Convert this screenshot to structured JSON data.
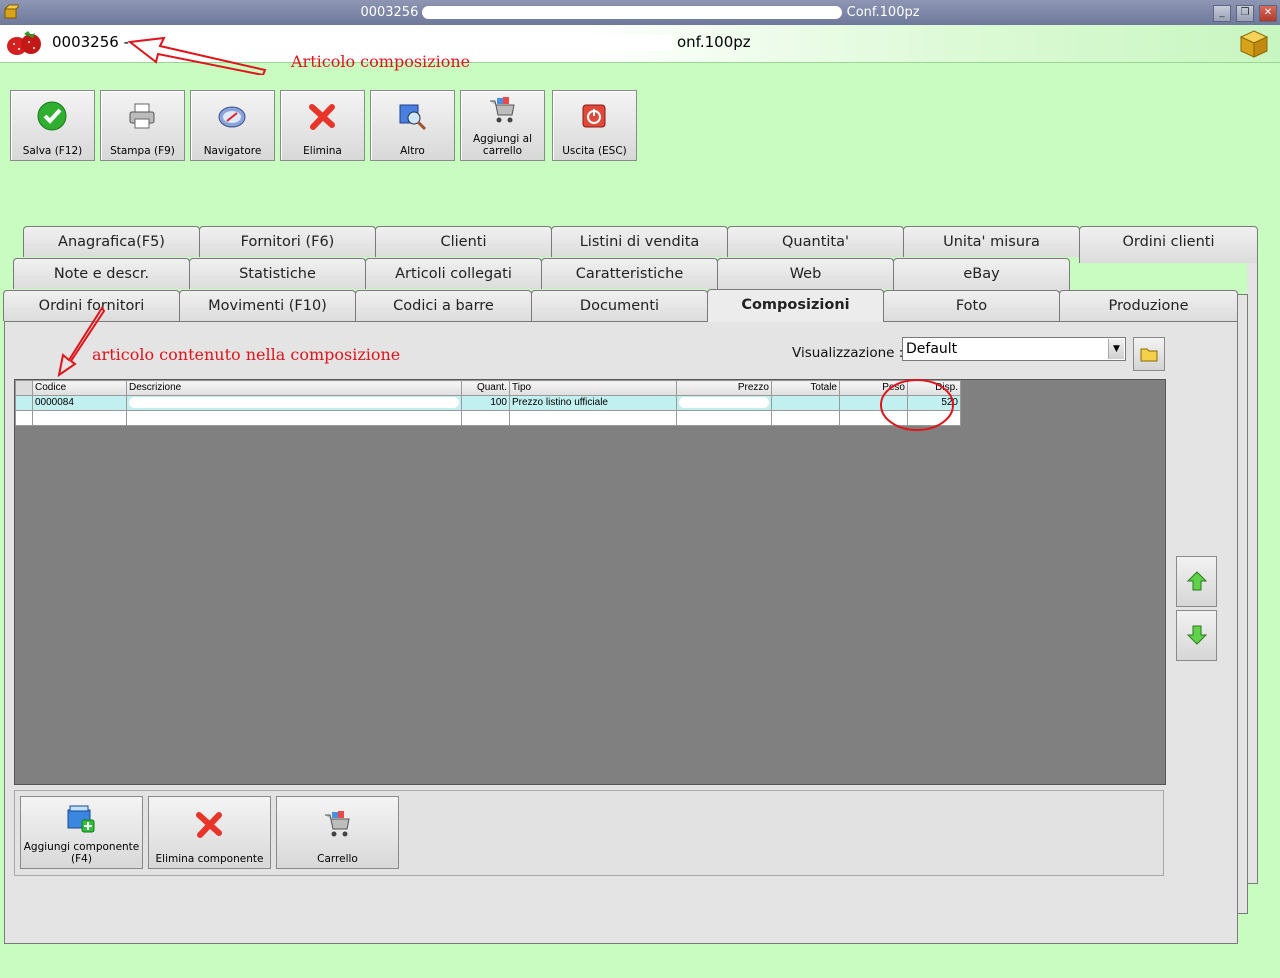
{
  "window": {
    "title_code": "0003256",
    "title_suffix": "Conf.100pz",
    "controls": [
      "_",
      "❐",
      "✕"
    ]
  },
  "header": {
    "article_code": "0003256 -",
    "article_suffix": "onf.100pz"
  },
  "annotations": {
    "top_note": "Articolo composizione",
    "grid_note": "articolo contenuto nella composizione"
  },
  "toolbar": {
    "save": "Salva (F12)",
    "print": "Stampa (F9)",
    "navigator": "Navigatore",
    "delete": "Elimina",
    "other": "Altro",
    "add_to_cart_1": "Aggiungi al",
    "add_to_cart_2": "carrello",
    "exit": "Uscita (ESC)"
  },
  "tabs": {
    "row1": [
      "Anagrafica(F5)",
      "Fornitori (F6)",
      "Clienti",
      "Listini di vendita",
      "Quantita'",
      "Unita' misura",
      "Ordini clienti"
    ],
    "row2": [
      "Note e descr.",
      "Statistiche",
      "Articoli collegati",
      "Caratteristiche",
      "Web",
      "eBay"
    ],
    "row3": [
      "Ordini fornitori",
      "Movimenti (F10)",
      "Codici a barre",
      "Documenti",
      "Composizioni",
      "Foto",
      "Produzione"
    ],
    "active": "Composizioni"
  },
  "view": {
    "label": "Visualizzazione :",
    "selected": "Default"
  },
  "grid": {
    "columns": [
      "Codice",
      "Descrizione",
      "Quant.",
      "Tipo",
      "Prezzo",
      "Totale",
      "Peso",
      "Disp."
    ],
    "rows": [
      {
        "codice": "0000084",
        "descrizione": "",
        "quant": "100",
        "tipo": "Prezzo listino ufficiale",
        "prezzo": "",
        "totale": "",
        "peso": "",
        "disp": "520"
      }
    ]
  },
  "bottom": {
    "add_component_1": "Aggiungi componente",
    "add_component_2": "(F4)",
    "delete_component": "Elimina componente",
    "cart": "Carrello"
  },
  "colors": {
    "background": "#c8fcc0",
    "titlebar": "#7d86a6",
    "annotation": "#e0141a",
    "selected_row": "#c2f0f0",
    "grid_bg": "#808080"
  }
}
